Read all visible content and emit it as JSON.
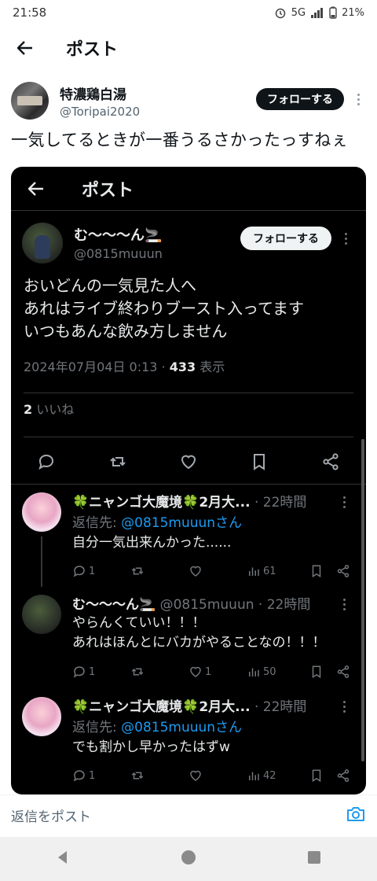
{
  "status_bar": {
    "time": "21:58",
    "network": "5G",
    "battery": "21%"
  },
  "header": {
    "title": "ポスト"
  },
  "outer_post": {
    "author_name": "特濃鶏白湯",
    "author_handle": "@Toripai2020",
    "follow_label": "フォローする",
    "text": "一気してるときが一番うるさかったっすねぇ"
  },
  "screenshot": {
    "header_title": "ポスト",
    "main_post": {
      "author_name": "む〜〜〜ん🚬",
      "author_handle": "@0815muuun",
      "follow_label": "フォローする",
      "lines": [
        "おいどんの一気見た人へ",
        "あれはライブ終わりブースト入ってます",
        "いつもあんな飲み方しません"
      ],
      "timestamp": "2024年07月04日 0:13 · ",
      "views_count": "433",
      "views_label": " 表示",
      "likes_count": "2",
      "likes_label": " いいね"
    },
    "replies": [
      {
        "name": "🍀ニャンゴ大魔境🍀2月大...",
        "handle": "",
        "time": " · 22時間",
        "reply_to_prefix": "返信先: ",
        "reply_to_user": "@0815muuunさん",
        "lines": [
          "自分一気出来んかった......"
        ],
        "reply_count": "1",
        "retweet_count": "",
        "like_count": "",
        "view_count": "61"
      },
      {
        "name": "む〜〜〜ん🚬",
        "handle": " @0815muuun",
        "time": " · 22時間",
        "reply_to_prefix": "",
        "reply_to_user": "",
        "lines": [
          "やらんくていい！！！",
          "あれはほんとにバカがやることなの！！！"
        ],
        "reply_count": "1",
        "retweet_count": "",
        "like_count": "1",
        "view_count": "50"
      },
      {
        "name": "🍀ニャンゴ大魔境🍀2月大...",
        "handle": "",
        "time": " · 22時間",
        "reply_to_prefix": "返信先: ",
        "reply_to_user": "@0815muuunさん",
        "lines": [
          "でも割かし早かったはずw"
        ],
        "reply_count": "1",
        "retweet_count": "",
        "like_count": "",
        "view_count": "42"
      }
    ]
  },
  "reply_bar": {
    "placeholder": "返信をポスト"
  },
  "icons": {
    "back": "arrow-left-icon",
    "more": "kebab-icon",
    "reply": "comment-icon",
    "retweet": "retweet-icon",
    "like": "heart-icon",
    "bookmark": "bookmark-icon",
    "share": "share-icon",
    "views": "bar-chart-icon",
    "camera": "camera-icon"
  },
  "colors": {
    "accent": "#1d9bf0",
    "dark_bg": "#000000",
    "follow_dark": "#0f1419"
  }
}
